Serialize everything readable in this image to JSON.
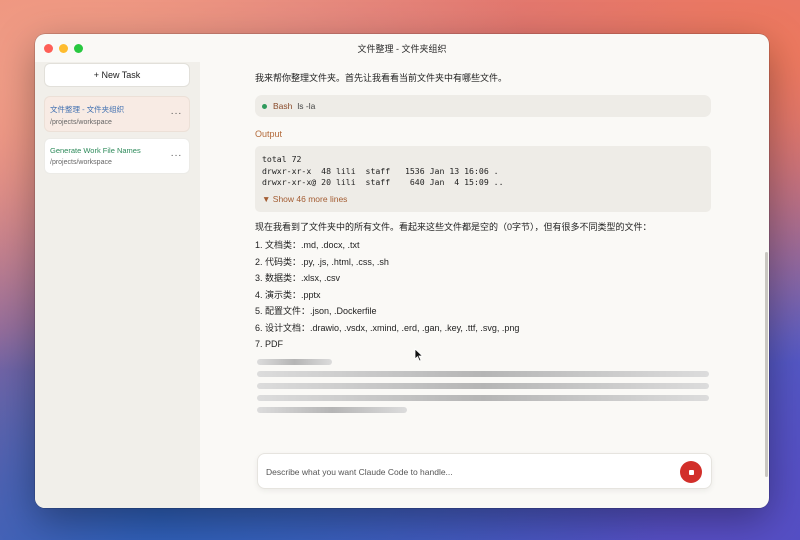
{
  "window": {
    "title": "文件整理 - 文件夹组织"
  },
  "sidebar": {
    "new_task_label": "+ New Task",
    "tasks": [
      {
        "title": "文件整理 - 文件夹组织",
        "path": "/projects/workspace",
        "more": "···",
        "active": true
      },
      {
        "title": "Generate Work File Names",
        "path": "/projects/workspace",
        "more": "···",
        "active": false
      }
    ]
  },
  "conversation": {
    "intro": "我来帮你整理文件夹。首先让我看看当前文件夹中有哪些文件。",
    "tool": {
      "name": "Bash",
      "command": "ls -la"
    },
    "output_label": "Output",
    "output_lines": [
      "total 72",
      "drwxr-xr-x  48 lili  staff   1536 Jan 13 16:06 .",
      "drwxr-xr-x@ 20 lili  staff    640 Jan  4 15:09 .."
    ],
    "show_more": "▼ Show 46 more lines",
    "summary": "现在我看到了文件夹中的所有文件。看起来这些文件都是空的（0字节），但有很多不同类型的文件：",
    "list": [
      "1. 文档类：.md, .docx, .txt",
      "2. 代码类：.py, .js, .html, .css, .sh",
      "3. 数据类：.xlsx, .csv",
      "4. 演示类：.pptx",
      "5. 配置文件：.json, .Dockerfile",
      "6. 设计文档：.drawio, .vsdx, .xmind, .erd, .gan, .key, .ttf, .svg, .png",
      "7. PDF"
    ]
  },
  "composer": {
    "placeholder": "Describe what you want Claude Code to handle..."
  },
  "colors": {
    "accent_output": "#b36a3a",
    "status_dot": "#2f9a5c",
    "stop_button": "#d22f2a",
    "active_task_bg": "#f8ebe4"
  },
  "icons": {
    "status": "green-dot-icon",
    "stop": "stop-square-icon",
    "cursor": "mouse-pointer-icon",
    "more": "ellipsis-icon"
  }
}
